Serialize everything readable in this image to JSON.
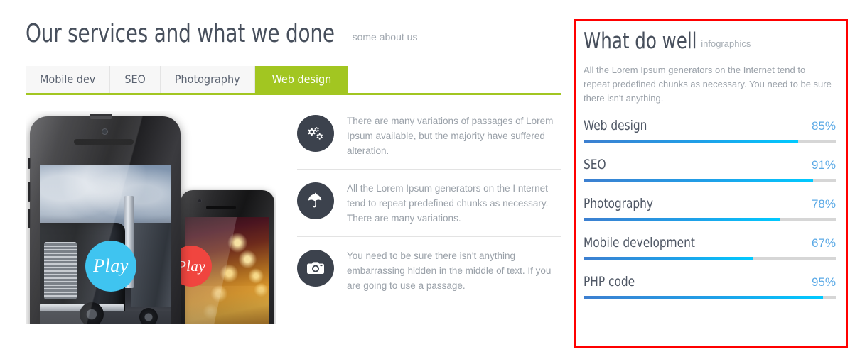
{
  "header": {
    "title": "Our services and what we done",
    "subtitle": "some about us"
  },
  "tabs": [
    {
      "label": "Mobile dev",
      "active": false
    },
    {
      "label": "SEO",
      "active": false
    },
    {
      "label": "Photography",
      "active": false
    },
    {
      "label": "Web design",
      "active": true
    }
  ],
  "showcase": {
    "front_phone": {
      "play_label": "Play",
      "play_color": "#3fc4f0",
      "photo": "truck-photo"
    },
    "back_phone": {
      "play_label": "Play",
      "play_color": "#f0453f",
      "photo": "tunnel-lights-photo"
    }
  },
  "features": [
    {
      "icon": "cogs-icon",
      "text": "There are many variations of passages of Lorem Ipsum available, but the majority have suffered alteration."
    },
    {
      "icon": "umbrella-icon",
      "text": "All the Lorem Ipsum generators on the I nternet tend to repeat predefined chunks as necessary. There are many variations."
    },
    {
      "icon": "camera-icon",
      "text": "You need to be sure there isn't anything embarrassing hidden in the middle of text. If you are going to use a passage."
    }
  ],
  "panel": {
    "title": "What do well",
    "subtitle": "infographics",
    "description": "All the Lorem Ipsum generators on the Internet tend to repeat predefined chunks as necessary. You need to be sure there isn't anything.",
    "border_color": "#ff0000"
  },
  "chart_data": {
    "type": "bar",
    "orientation": "horizontal",
    "title": "What do well",
    "subtitle": "infographics",
    "xlabel": "",
    "ylabel": "",
    "xlim": [
      0,
      100
    ],
    "unit": "%",
    "grid": false,
    "legend": "none",
    "track_color": "#d6d6d6",
    "bar_gradient": [
      "#3d7fd0",
      "#00caff"
    ],
    "value_color": "#5aa9e6",
    "categories": [
      "Web design",
      "SEO",
      "Photography",
      "Mobile development",
      "PHP code"
    ],
    "values": [
      85,
      91,
      78,
      67,
      95
    ],
    "labels": [
      "85%",
      "91%",
      "78%",
      "67%",
      "95%"
    ]
  }
}
